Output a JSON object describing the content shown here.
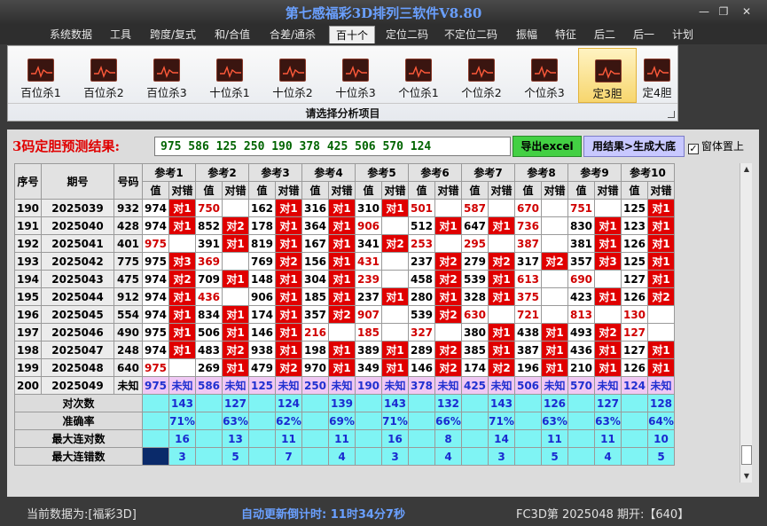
{
  "window": {
    "title": "第七感福彩3D排列三软件V8.80"
  },
  "menu": [
    "系统数据",
    "工具",
    "跨度/复式",
    "和/合值",
    "合差/通杀",
    "百十个",
    "定位二码",
    "不定位二码",
    "振幅",
    "特征",
    "后二",
    "后一",
    "计划"
  ],
  "ribbon": {
    "buttons": [
      "百位杀1",
      "百位杀2",
      "百位杀3",
      "十位杀1",
      "十位杀2",
      "十位杀3",
      "个位杀1",
      "个位杀2",
      "个位杀3",
      "定3胆",
      "定4胆"
    ],
    "caption": "请选择分析项目"
  },
  "prediction": {
    "label": "3码定胆预测结果:",
    "values": "975 586 125 250 190 378 425 506 570 124",
    "export_label": "导出excel",
    "generate_label": "用结果>生成大底",
    "topmost_label": "窗体置上"
  },
  "grid": {
    "headers": {
      "idx": "序号",
      "period": "期号",
      "num": "号码",
      "value": "值",
      "result": "对错"
    },
    "refs": [
      "参考1",
      "参考2",
      "参考3",
      "参考4",
      "参考5",
      "参考6",
      "参考7",
      "参考8",
      "参考9",
      "参考10"
    ],
    "rows": [
      {
        "idx": "190",
        "period": "2025039",
        "num": "932",
        "cells": [
          [
            "974",
            "对1"
          ],
          [
            "750",
            ""
          ],
          [
            "162",
            "对1"
          ],
          [
            "316",
            "对1"
          ],
          [
            "310",
            "对1"
          ],
          [
            "501",
            ""
          ],
          [
            "587",
            ""
          ],
          [
            "670",
            ""
          ],
          [
            "751",
            ""
          ],
          [
            "125",
            "对1"
          ]
        ]
      },
      {
        "idx": "191",
        "period": "2025040",
        "num": "428",
        "cells": [
          [
            "974",
            "对1"
          ],
          [
            "852",
            "对2"
          ],
          [
            "178",
            "对1"
          ],
          [
            "364",
            "对1"
          ],
          [
            "906",
            ""
          ],
          [
            "512",
            "对1"
          ],
          [
            "647",
            "对1"
          ],
          [
            "736",
            ""
          ],
          [
            "830",
            "对1"
          ],
          [
            "123",
            "对1"
          ]
        ]
      },
      {
        "idx": "192",
        "period": "2025041",
        "num": "401",
        "cells": [
          [
            "975",
            ""
          ],
          [
            "391",
            "对1"
          ],
          [
            "819",
            "对1"
          ],
          [
            "167",
            "对1"
          ],
          [
            "341",
            "对2"
          ],
          [
            "253",
            ""
          ],
          [
            "295",
            ""
          ],
          [
            "387",
            ""
          ],
          [
            "381",
            "对1"
          ],
          [
            "126",
            "对1"
          ]
        ]
      },
      {
        "idx": "193",
        "period": "2025042",
        "num": "775",
        "cells": [
          [
            "975",
            "对3"
          ],
          [
            "369",
            ""
          ],
          [
            "769",
            "对2"
          ],
          [
            "156",
            "对1"
          ],
          [
            "431",
            ""
          ],
          [
            "237",
            "对2"
          ],
          [
            "279",
            "对2"
          ],
          [
            "317",
            "对2"
          ],
          [
            "357",
            "对3"
          ],
          [
            "125",
            "对1"
          ]
        ]
      },
      {
        "idx": "194",
        "period": "2025043",
        "num": "475",
        "cells": [
          [
            "974",
            "对2"
          ],
          [
            "709",
            "对1"
          ],
          [
            "148",
            "对1"
          ],
          [
            "304",
            "对1"
          ],
          [
            "239",
            ""
          ],
          [
            "458",
            "对2"
          ],
          [
            "539",
            "对1"
          ],
          [
            "613",
            ""
          ],
          [
            "690",
            ""
          ],
          [
            "127",
            "对1"
          ]
        ]
      },
      {
        "idx": "195",
        "period": "2025044",
        "num": "912",
        "cells": [
          [
            "974",
            "对1"
          ],
          [
            "436",
            ""
          ],
          [
            "906",
            "对1"
          ],
          [
            "185",
            "对1"
          ],
          [
            "237",
            "对1"
          ],
          [
            "280",
            "对1"
          ],
          [
            "328",
            "对1"
          ],
          [
            "375",
            ""
          ],
          [
            "423",
            "对1"
          ],
          [
            "126",
            "对2"
          ]
        ]
      },
      {
        "idx": "196",
        "period": "2025045",
        "num": "554",
        "cells": [
          [
            "974",
            "对1"
          ],
          [
            "834",
            "对1"
          ],
          [
            "174",
            "对1"
          ],
          [
            "357",
            "对2"
          ],
          [
            "907",
            ""
          ],
          [
            "539",
            "对2"
          ],
          [
            "630",
            ""
          ],
          [
            "721",
            ""
          ],
          [
            "813",
            ""
          ],
          [
            "130",
            ""
          ]
        ]
      },
      {
        "idx": "197",
        "period": "2025046",
        "num": "490",
        "cells": [
          [
            "975",
            "对1"
          ],
          [
            "506",
            "对1"
          ],
          [
            "146",
            "对1"
          ],
          [
            "216",
            ""
          ],
          [
            "185",
            ""
          ],
          [
            "327",
            ""
          ],
          [
            "380",
            "对1"
          ],
          [
            "438",
            "对1"
          ],
          [
            "493",
            "对2"
          ],
          [
            "127",
            ""
          ]
        ]
      },
      {
        "idx": "198",
        "period": "2025047",
        "num": "248",
        "cells": [
          [
            "974",
            "对1"
          ],
          [
            "483",
            "对2"
          ],
          [
            "938",
            "对1"
          ],
          [
            "198",
            "对1"
          ],
          [
            "389",
            "对1"
          ],
          [
            "289",
            "对2"
          ],
          [
            "385",
            "对1"
          ],
          [
            "387",
            "对1"
          ],
          [
            "436",
            "对1"
          ],
          [
            "127",
            "对1"
          ]
        ]
      },
      {
        "idx": "199",
        "period": "2025048",
        "num": "640",
        "cells": [
          [
            "975",
            ""
          ],
          [
            "269",
            "对1"
          ],
          [
            "479",
            "对2"
          ],
          [
            "970",
            "对1"
          ],
          [
            "349",
            "对1"
          ],
          [
            "146",
            "对2"
          ],
          [
            "174",
            "对2"
          ],
          [
            "196",
            "对1"
          ],
          [
            "210",
            "对1"
          ],
          [
            "126",
            "对1"
          ]
        ]
      }
    ],
    "future": {
      "idx": "200",
      "period": "2025049",
      "num": "未知",
      "values": [
        "975",
        "586",
        "125",
        "250",
        "190",
        "378",
        "425",
        "506",
        "570",
        "124"
      ],
      "result": "未知"
    },
    "stats": [
      {
        "label": "对次数",
        "values": [
          "143",
          "127",
          "124",
          "139",
          "143",
          "132",
          "143",
          "126",
          "127",
          "128"
        ]
      },
      {
        "label": "准确率",
        "values": [
          "71%",
          "63%",
          "62%",
          "69%",
          "71%",
          "66%",
          "71%",
          "63%",
          "63%",
          "64%"
        ]
      },
      {
        "label": "最大连对数",
        "values": [
          "16",
          "13",
          "11",
          "11",
          "16",
          "8",
          "14",
          "11",
          "11",
          "10"
        ]
      },
      {
        "label": "最大连错数",
        "values": [
          "3",
          "5",
          "7",
          "4",
          "3",
          "4",
          "3",
          "5",
          "4",
          "5"
        ]
      }
    ]
  },
  "status": {
    "data_label": "当前数据为:[福彩3D]",
    "timer_label": "自动更新倒计时:  11时34分7秒",
    "issue_label": "FC3D第 2025048 期开:【640】"
  }
}
